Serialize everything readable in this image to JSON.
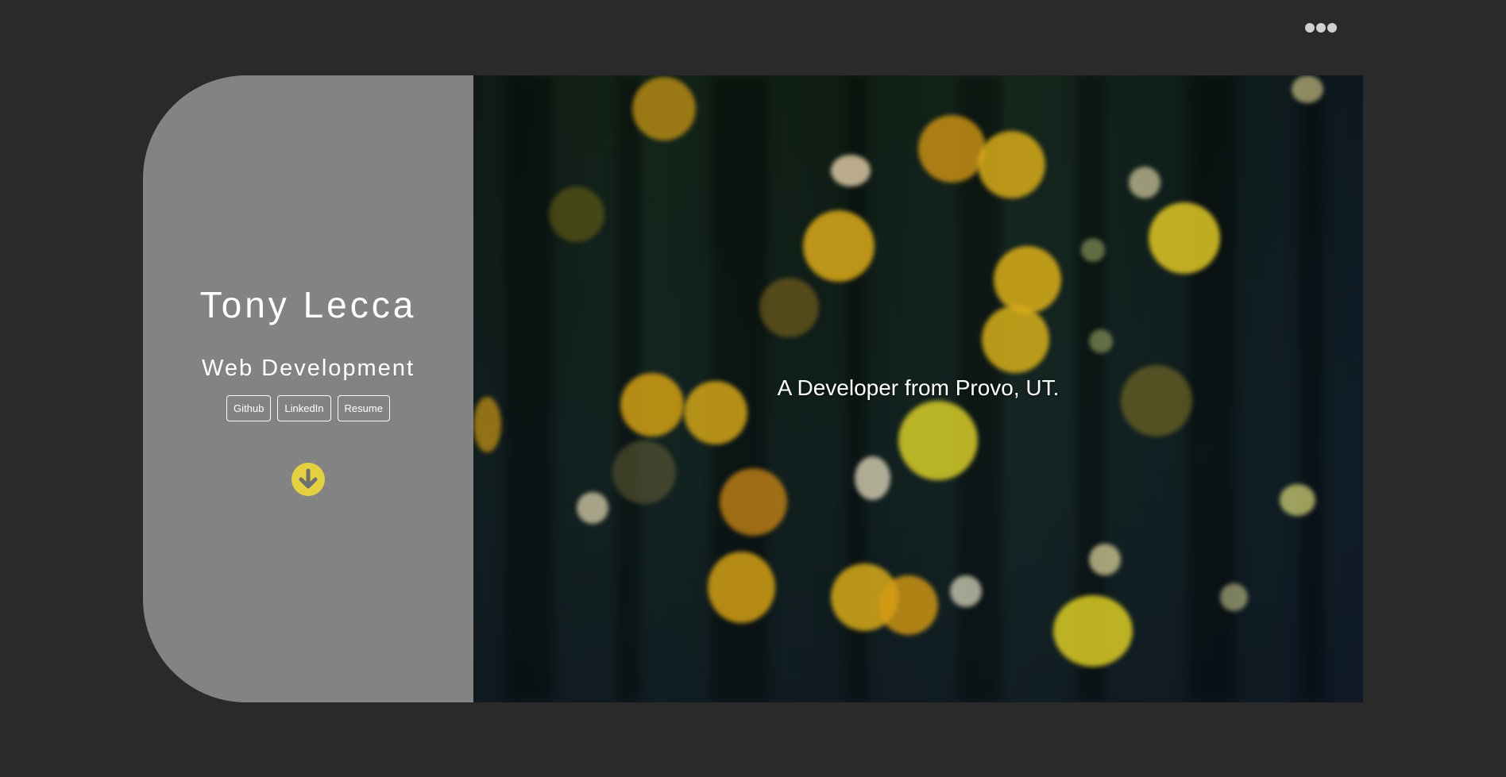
{
  "header": {
    "menu_icon": "more-horizontal-icon"
  },
  "profile": {
    "name": "Tony Lecca",
    "role": "Web Development",
    "links": [
      {
        "label": "Github"
      },
      {
        "label": "LinkedIn"
      },
      {
        "label": "Resume"
      }
    ],
    "scroll_icon": "arrow-down-circle-icon"
  },
  "hero": {
    "tagline": "A Developer from Provo, UT."
  },
  "colors": {
    "background": "#2a2a2a",
    "panel": "#838383",
    "accent": "#e3d140"
  }
}
